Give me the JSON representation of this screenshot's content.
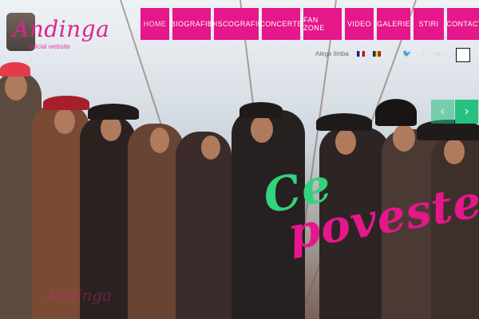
{
  "brand": {
    "logo_text": "Andinga",
    "logo_subtext": "official website",
    "accent_color": "#e6168b",
    "secondary_color": "#27c080"
  },
  "nav": {
    "items": [
      {
        "label": "HOME",
        "active": true
      },
      {
        "label": "BIOGRAFIE",
        "active": false
      },
      {
        "label": "DISCOGRAFIE",
        "active": false
      },
      {
        "label": "CONCERTE",
        "active": false
      },
      {
        "label": "FAN ZONE",
        "active": false
      },
      {
        "label": "VIDEO",
        "active": false
      },
      {
        "label": "GALERIE",
        "active": false
      },
      {
        "label": "STIRI",
        "active": false
      },
      {
        "label": "CONTACT",
        "active": false
      }
    ]
  },
  "utility": {
    "text": "Alege limba",
    "languages": [
      "en",
      "ro"
    ],
    "social_icons": [
      "twitter-icon",
      "facebook-icon",
      "youtube-icon",
      "google-plus-icon"
    ]
  },
  "hero": {
    "headline_line1": "Ce",
    "headline_line2": "poveste",
    "watermark": "Andinga"
  },
  "slider": {
    "prev_label": "‹",
    "next_label": "›"
  }
}
